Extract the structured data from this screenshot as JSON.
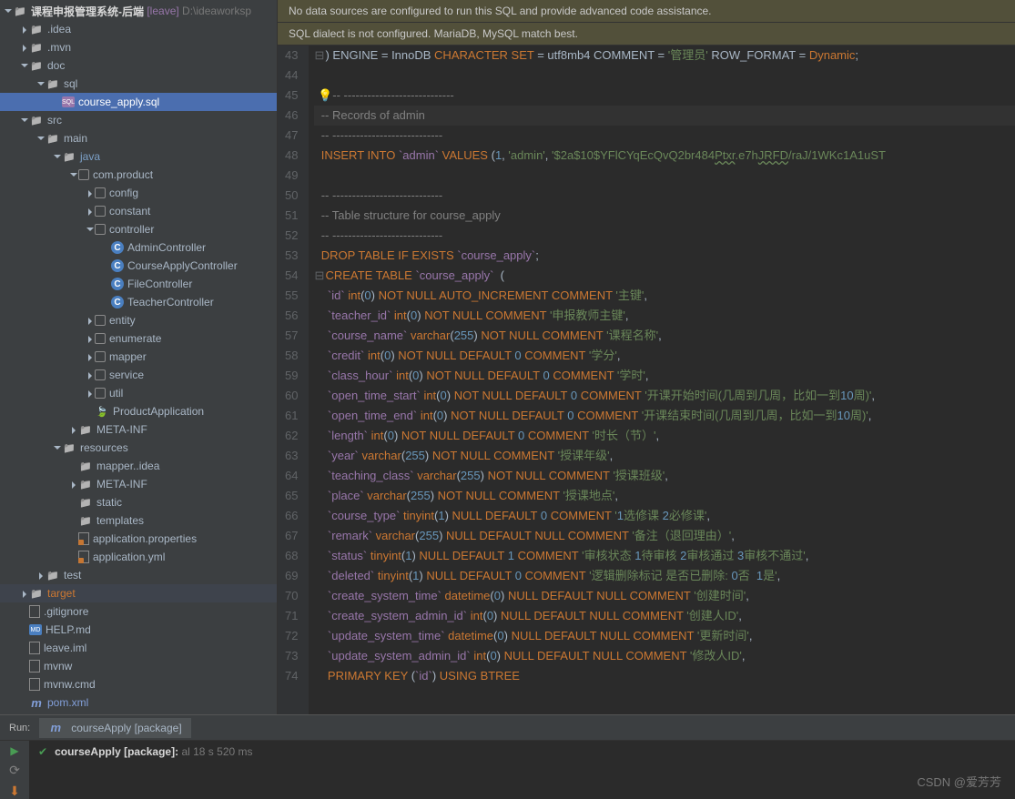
{
  "project": {
    "name": "课程申报管理系统-后端",
    "tag": "[leave]",
    "path": "D:\\ideaworksp"
  },
  "tree": {
    "idea": ".idea",
    "mvn": ".mvn",
    "doc": "doc",
    "sql": "sql",
    "sqlfile": "course_apply.sql",
    "src": "src",
    "main": "main",
    "java": "java",
    "pkg": "com.product",
    "config": "config",
    "constant": "constant",
    "controller": "controller",
    "c1": "AdminController",
    "c2": "CourseApplyController",
    "c3": "FileController",
    "c4": "TeacherController",
    "entity": "entity",
    "enumerate": "enumerate",
    "mapper": "mapper",
    "service": "service",
    "util": "util",
    "app": "ProductApplication",
    "metainf": "META-INF",
    "resources": "resources",
    "mapperidea": "mapper..idea",
    "metainf2": "META-INF",
    "static": "static",
    "templates": "templates",
    "appprops": "application.properties",
    "appyml": "application.yml",
    "test": "test",
    "target": "target",
    "gitignore": ".gitignore",
    "help": "HELP.md",
    "leaveiml": "leave.iml",
    "mvnw": "mvnw",
    "mvnwcmd": "mvnw.cmd",
    "pomxml": "pom.xml"
  },
  "banner1": "No data sources are configured to run this SQL and provide advanced code assistance.",
  "banner2": "SQL dialect is not configured. MariaDB, MySQL match best.",
  "lines": {
    "start": 43,
    "end": 74
  },
  "code": {
    "l43_a": ") ENGINE = InnoDB ",
    "l43_b": "CHARACTER SET",
    "l43_c": " = utf8mb4 COMMENT = ",
    "l43_d": "'管理员'",
    "l43_e": " ROW_FORMAT = ",
    "l43_f": "Dynamic",
    "l43_g": ";",
    "l45": "-- ----------------------------",
    "l46": "-- Records of admin",
    "l47": "-- ----------------------------",
    "l48_a": "INSERT INTO ",
    "l48_b": "`admin`",
    "l48_c": " VALUES ",
    "l48_d": "(",
    "l48_n": "1",
    "l48_e": ", ",
    "l48_f": "'admin'",
    "l48_g": ", ",
    "l48_h": "'$2a$10$YFlCYqEcQvQ2br484",
    "l48_i": "Ptxr",
    "l48_j": ".e7h",
    "l48_k": "JRFD",
    "l48_l": "/raJ/1WKc1A1uST",
    "l50": "-- ----------------------------",
    "l51": "-- Table structure for course_apply",
    "l52": "-- ----------------------------",
    "l53_a": "DROP TABLE IF EXISTS ",
    "l53_b": "`course_apply`",
    "l53_c": ";",
    "l54_a": "CREATE TABLE ",
    "l54_b": "`course_apply`",
    "l54_c": "  (",
    "l55": "  `id` int(0) NOT NULL AUTO_INCREMENT COMMENT '主键',",
    "l56": "  `teacher_id` int(0) NOT NULL COMMENT '申报教师主键',",
    "l57": "  `course_name` varchar(255) NOT NULL COMMENT '课程名称',",
    "l58": "  `credit` int(0) NOT NULL DEFAULT 0 COMMENT '学分',",
    "l59": "  `class_hour` int(0) NOT NULL DEFAULT 0 COMMENT '学时',",
    "l60": "  `open_time_start` int(0) NOT NULL DEFAULT 0 COMMENT '开课开始时间(几周到几周，比如一到10周)',",
    "l61": "  `open_time_end` int(0) NOT NULL DEFAULT 0 COMMENT '开课结束时间(几周到几周，比如一到10周)',",
    "l62": "  `length` int(0) NOT NULL DEFAULT 0 COMMENT '时长（节）',",
    "l63": "  `year` varchar(255) NOT NULL COMMENT '授课年级',",
    "l64": "  `teaching_class` varchar(255) NOT NULL COMMENT '授课班级',",
    "l65": "  `place` varchar(255) NOT NULL COMMENT '授课地点',",
    "l66": "  `course_type` tinyint(1) NULL DEFAULT 0 COMMENT '1选修课 2必修课',",
    "l67": "  `remark` varchar(255) NULL DEFAULT NULL COMMENT '备注（退回理由）',",
    "l68": "  `status` tinyint(1) NULL DEFAULT 1 COMMENT '审核状态 1待审核 2审核通过 3审核不通过',",
    "l69": "  `deleted` tinyint(1) NULL DEFAULT 0 COMMENT '逻辑删除标记 是否已删除: 0否  1是',",
    "l70": "  `create_system_time` datetime(0) NULL DEFAULT NULL COMMENT '创建时间',",
    "l71": "  `create_system_admin_id` int(0) NULL DEFAULT NULL COMMENT '创建人ID',",
    "l72": "  `update_system_time` datetime(0) NULL DEFAULT NULL COMMENT '更新时间',",
    "l73": "  `update_system_admin_id` int(0) NULL DEFAULT NULL COMMENT '修改人ID',",
    "l74": "  PRIMARY KEY (`id`) USING BTREE"
  },
  "run": {
    "label": "Run:",
    "tab": "courseApply [package]",
    "out_a": "courseApply [package]:",
    "out_b": "al 18 s 520 ms"
  },
  "watermark": "CSDN @爱芳芳"
}
